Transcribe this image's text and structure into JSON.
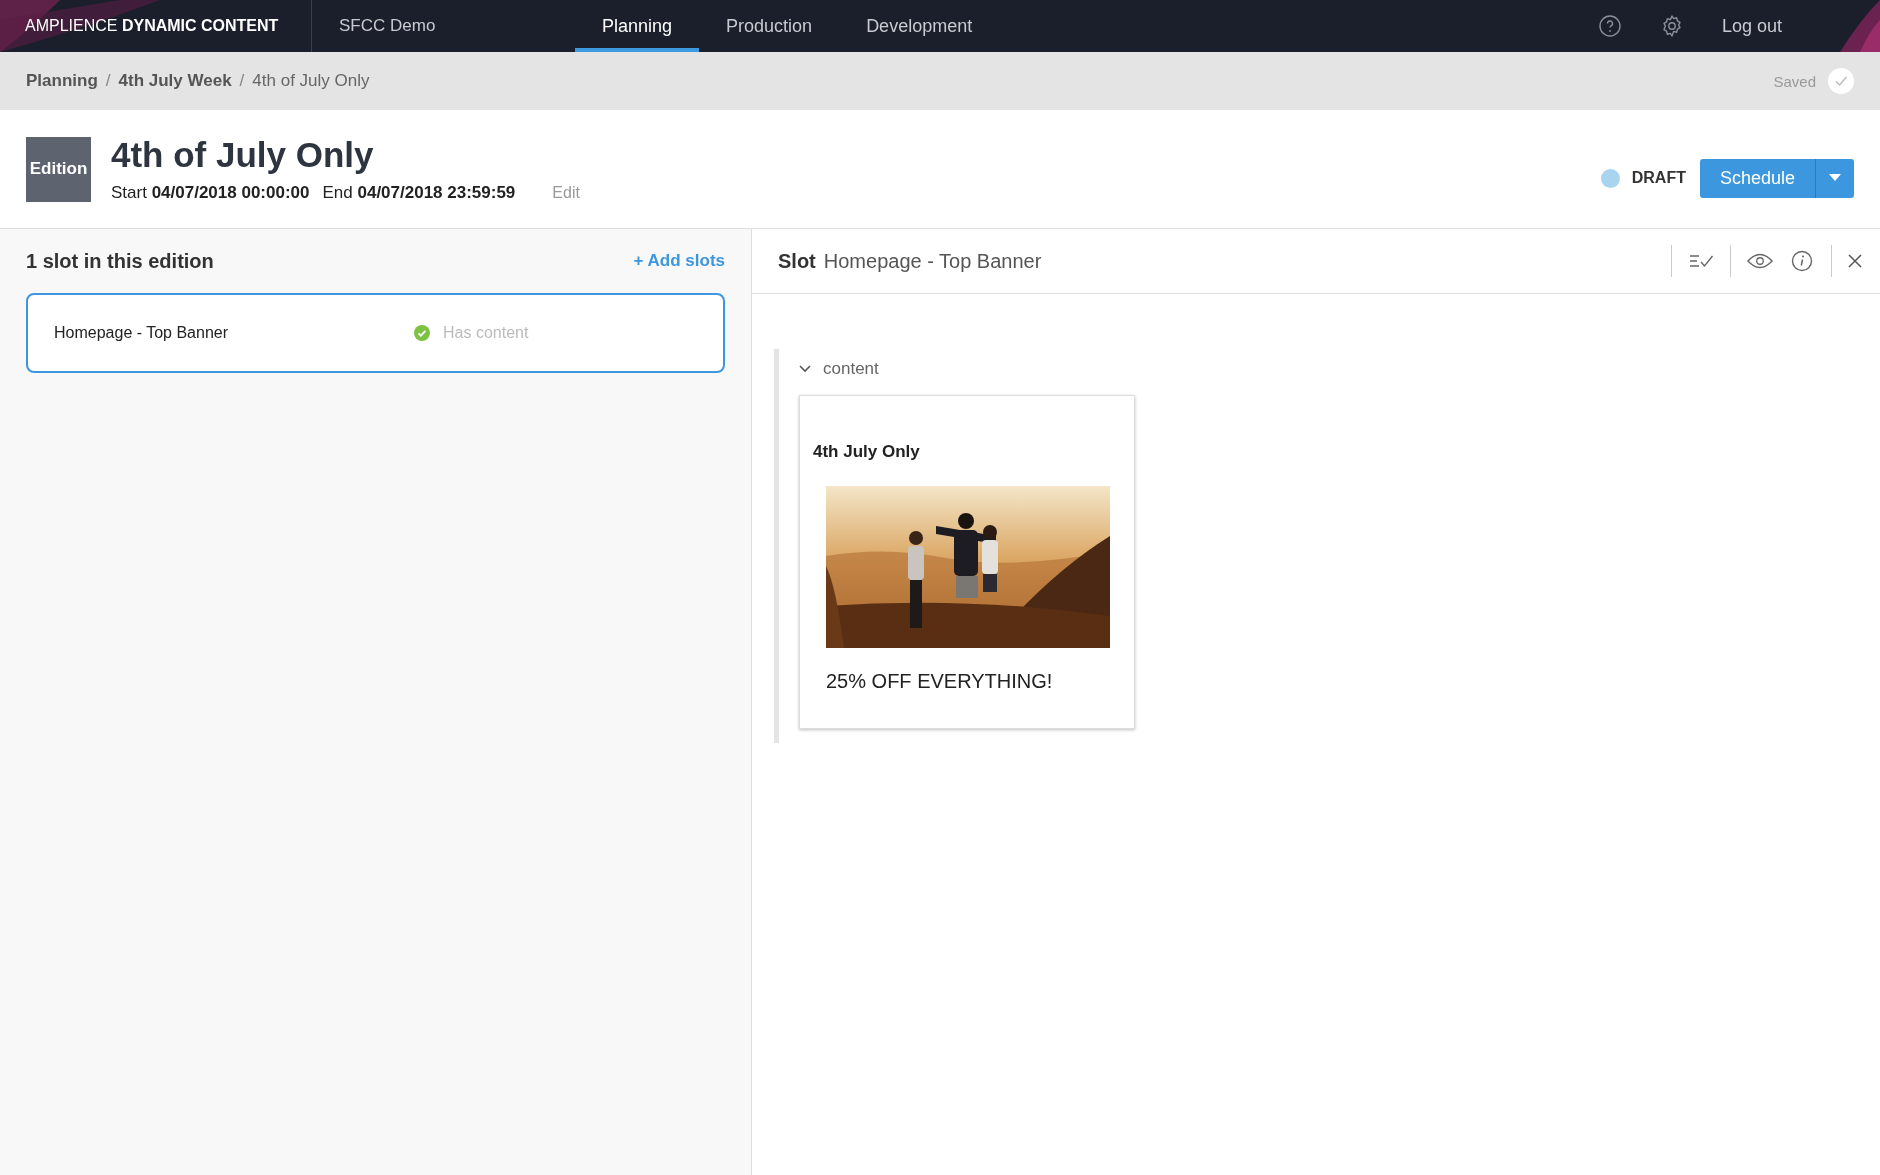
{
  "topbar": {
    "brand": "AMPLIENCE **DYNAMIC CONTENT**",
    "hub": "SFCC Demo",
    "tabs": [
      {
        "label": "Planning",
        "selected": true
      },
      {
        "label": "Production",
        "selected": false
      },
      {
        "label": "Development",
        "selected": false
      }
    ],
    "logout": "Log out"
  },
  "breadcrumbs": [
    {
      "label": "Planning",
      "current": false
    },
    {
      "label": "4th July Week",
      "separator": "/",
      "current": false
    },
    {
      "label": "4th of July Only",
      "separator": "/",
      "current": true
    }
  ],
  "save_status": {
    "label": "Saved",
    "saved": true
  },
  "edition": {
    "badge": "Edition",
    "title": "4th of July Only",
    "start": "Start **04/07/2018 00:00:00**",
    "end": "End **04/07/2018 23:59:59**",
    "edit": "Edit",
    "status": {
      "label": "DRAFT",
      "color": "#a8d4ef"
    },
    "schedule": "Schedule"
  },
  "slots_panel": {
    "title": "1 slot in this edition",
    "add": "+ Add slots",
    "slots": [
      {
        "name": "Homepage - Top Banner",
        "status": "Has content",
        "has_content": true,
        "selected": true
      }
    ]
  },
  "slot_detail": {
    "label": "Slot",
    "name": "Homepage - Top Banner",
    "section": "content",
    "expanded": true,
    "card": {
      "heading": "4th July Only",
      "caption": "25% OFF EVERYTHING!"
    }
  }
}
